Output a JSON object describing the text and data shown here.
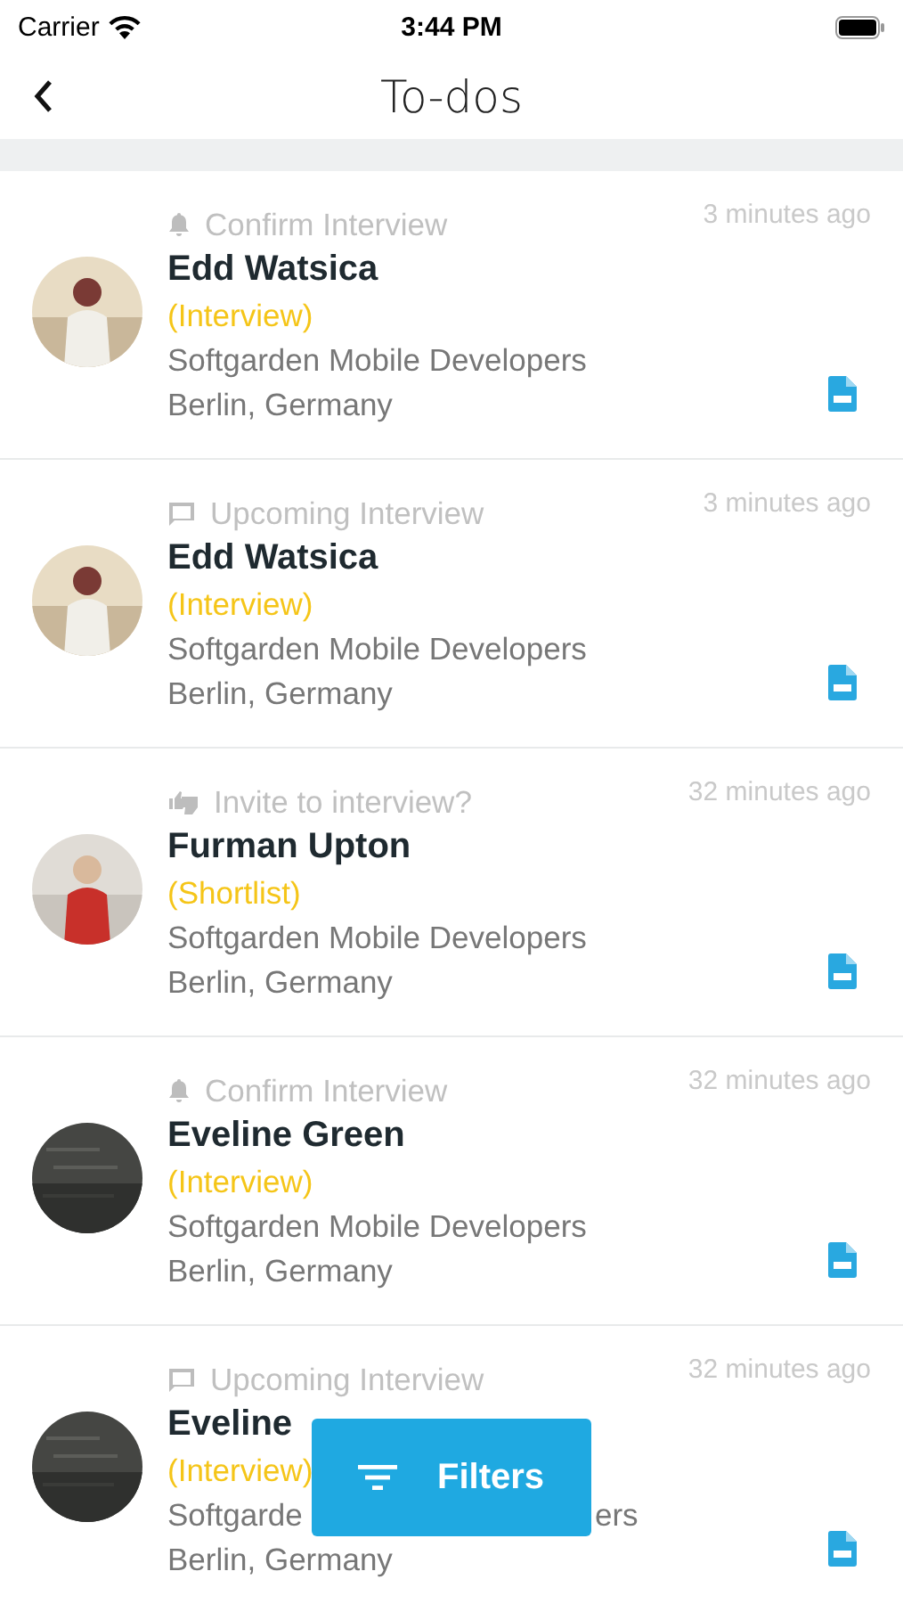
{
  "status_bar": {
    "carrier": "Carrier",
    "time": "3:44 PM"
  },
  "nav": {
    "title": "To-dos"
  },
  "todos": [
    {
      "event": {
        "kind": "bell",
        "label": "Confirm Interview"
      },
      "time": "3 minutes ago",
      "name": "Edd Watsica",
      "stage": "(Interview)",
      "company": "Softgarden Mobile Developers",
      "location": "Berlin, Germany"
    },
    {
      "event": {
        "kind": "message",
        "label": "Upcoming Interview"
      },
      "time": "3 minutes ago",
      "name": "Edd Watsica",
      "stage": "(Interview)",
      "company": "Softgarden Mobile Developers",
      "location": "Berlin, Germany"
    },
    {
      "event": {
        "kind": "thumbs",
        "label": "Invite to interview?"
      },
      "time": "32 minutes ago",
      "name": "Furman Upton",
      "stage": "(Shortlist)",
      "company": "Softgarden Mobile Developers",
      "location": "Berlin, Germany"
    },
    {
      "event": {
        "kind": "bell",
        "label": "Confirm Interview"
      },
      "time": "32 minutes ago",
      "name": "Eveline Green",
      "stage": "(Interview)",
      "company": "Softgarden Mobile Developers",
      "location": "Berlin, Germany"
    },
    {
      "event": {
        "kind": "message",
        "label": "Upcoming Interview"
      },
      "time": "32 minutes ago",
      "name": "Eveline",
      "stage": "(Interview)",
      "company": "Softgarde",
      "company_tail": "ers",
      "location": "Berlin, Germany"
    }
  ],
  "filters_button": {
    "label": "Filters"
  }
}
